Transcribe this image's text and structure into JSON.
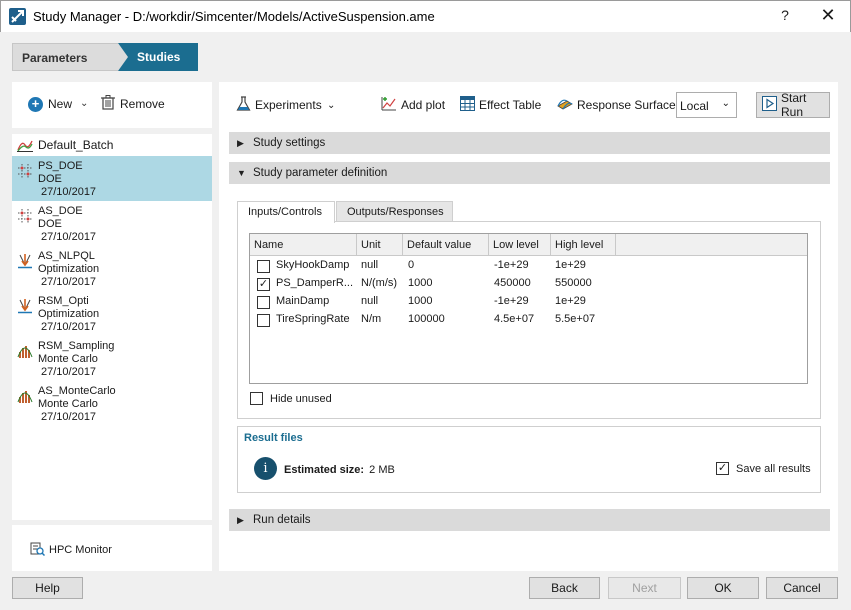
{
  "window": {
    "title": "Study Manager - D:/workdir/Simcenter/Models/ActiveSuspension.ame",
    "help_label": "?",
    "close_label": "✕"
  },
  "breadcrumb": {
    "parameters": "Parameters",
    "studies": "Studies"
  },
  "left_toolbar": {
    "new_label": "New",
    "remove_label": "Remove"
  },
  "studies": [
    {
      "name": "Default_Batch",
      "type": "",
      "date": "",
      "icon": "batch-icon",
      "selected": false
    },
    {
      "name": "PS_DOE",
      "type": "DOE",
      "date": "27/10/2017",
      "icon": "doe-icon",
      "selected": true
    },
    {
      "name": "AS_DOE",
      "type": "DOE",
      "date": "27/10/2017",
      "icon": "doe-icon",
      "selected": false
    },
    {
      "name": "AS_NLPQL",
      "type": "Optimization",
      "date": "27/10/2017",
      "icon": "optimization-icon",
      "selected": false
    },
    {
      "name": "RSM_Opti",
      "type": "Optimization",
      "date": "27/10/2017",
      "icon": "optimization-icon",
      "selected": false
    },
    {
      "name": "RSM_Sampling",
      "type": "Monte Carlo",
      "date": "27/10/2017",
      "icon": "monte-carlo-icon",
      "selected": false
    },
    {
      "name": "AS_MonteCarlo",
      "type": "Monte Carlo",
      "date": "27/10/2017",
      "icon": "monte-carlo-icon",
      "selected": false
    }
  ],
  "hpc_monitor_label": "HPC Monitor",
  "toolbar": {
    "experiments_label": "Experiments",
    "add_plot_label": "Add plot",
    "effect_table_label": "Effect Table",
    "response_surface_label": "Response Surface",
    "run_location": "Local",
    "start_run_label": "Start Run"
  },
  "sections": {
    "study_settings": "Study settings",
    "study_parameter_definition": "Study parameter definition",
    "run_details": "Run details"
  },
  "tabs": {
    "inputs": "Inputs/Controls",
    "outputs": "Outputs/Responses"
  },
  "parameter_table": {
    "columns": [
      "Name",
      "Unit",
      "Default value",
      "Low level",
      "High level"
    ],
    "rows": [
      {
        "checked": false,
        "name": "SkyHookDamp",
        "unit": "null",
        "default": "0",
        "low": "-1e+29",
        "high": "1e+29"
      },
      {
        "checked": true,
        "name": "PS_DamperR...",
        "unit": "N/(m/s)",
        "default": "1000",
        "low": "450000",
        "high": "550000"
      },
      {
        "checked": false,
        "name": "MainDamp",
        "unit": "null",
        "default": "1000",
        "low": "-1e+29",
        "high": "1e+29"
      },
      {
        "checked": false,
        "name": "TireSpringRate",
        "unit": "N/m",
        "default": "100000",
        "low": "4.5e+07",
        "high": "5.5e+07"
      }
    ]
  },
  "hide_unused_label": "Hide unused",
  "result_files": {
    "title": "Result files",
    "estimated_size_label": "Estimated size:",
    "estimated_size_value": "2 MB",
    "save_all_label": "Save all results",
    "save_all_checked": true
  },
  "footer": {
    "help": "Help",
    "back": "Back",
    "next": "Next",
    "ok": "OK",
    "cancel": "Cancel"
  },
  "colors": {
    "accent": "#1b6d90",
    "selection": "#add8e4",
    "info_icon": "#17506d"
  }
}
